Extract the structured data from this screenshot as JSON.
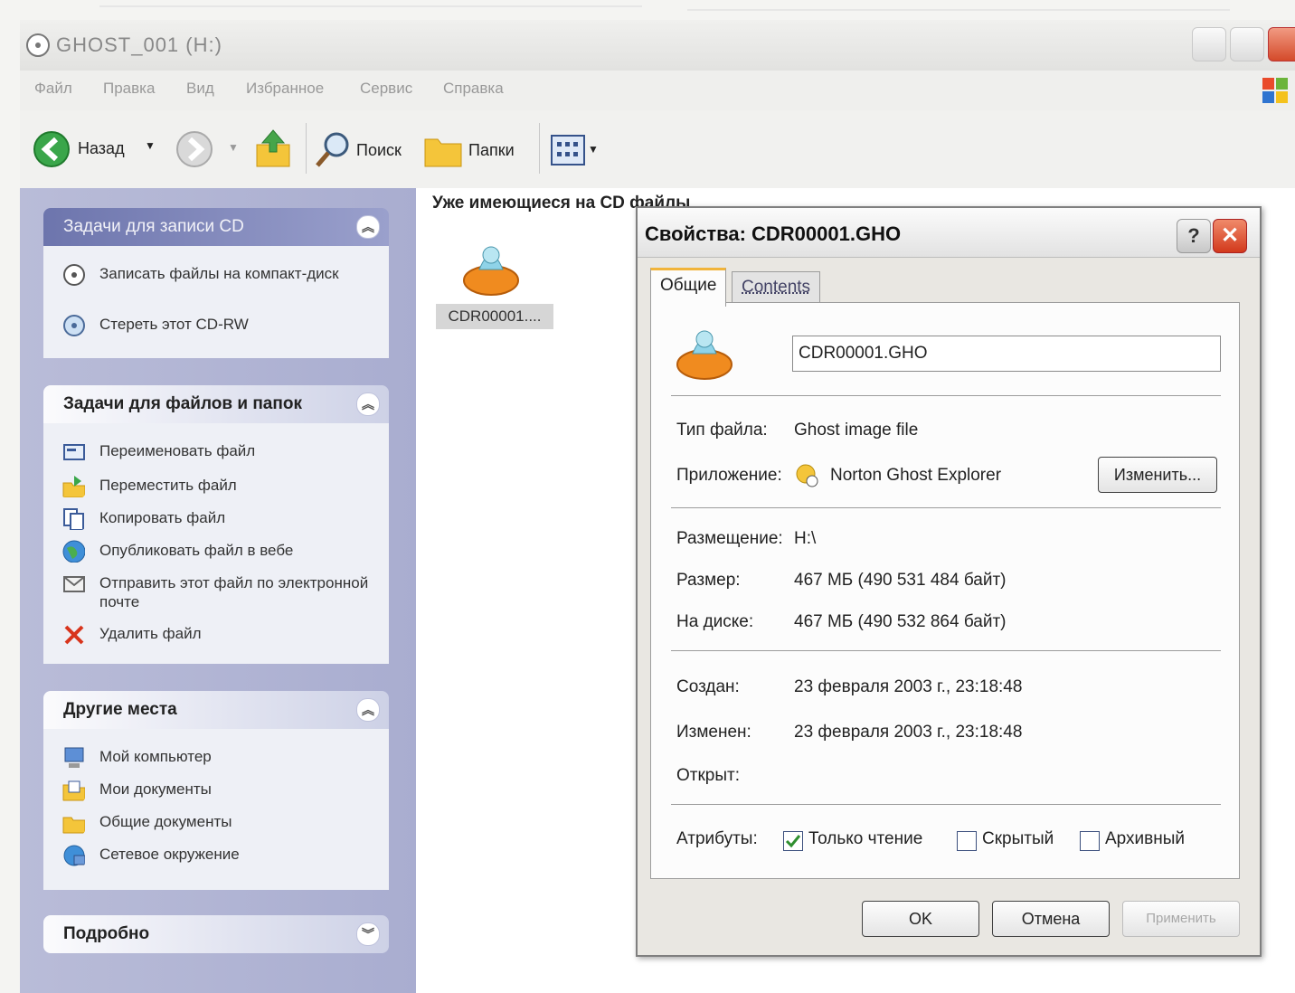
{
  "window": {
    "title": "GHOST_001 (H:)"
  },
  "menubar": {
    "items": [
      "Файл",
      "Правка",
      "Вид",
      "Избранное",
      "Сервис",
      "Справка"
    ]
  },
  "toolbar": {
    "back_label": "Назад",
    "search_label": "Поиск",
    "folders_label": "Папки"
  },
  "taskpane": {
    "cd_tasks": {
      "title": "Задачи для записи CD",
      "items": [
        "Записать файлы на компакт-диск",
        "Стереть этот CD-RW"
      ]
    },
    "file_tasks": {
      "title": "Задачи для файлов и папок",
      "items": [
        "Переименовать файл",
        "Переместить файл",
        "Копировать файл",
        "Опубликовать файл в вебе",
        "Отправить этот файл по электронной почте",
        "Удалить файл"
      ]
    },
    "other_places": {
      "title": "Другие места",
      "items": [
        "Мой компьютер",
        "Мои документы",
        "Общие документы",
        "Сетевое окружение"
      ]
    },
    "details": {
      "title": "Подробно"
    }
  },
  "content": {
    "section_title": "Уже имеющиеся на CD файлы",
    "file_label": "CDR00001...."
  },
  "dialog": {
    "title": "Свойства: CDR00001.GHO",
    "tabs": [
      "Общие",
      "Contents"
    ],
    "filename": "CDR00001.GHO",
    "type_label": "Тип файла:",
    "type_value": "Ghost image file",
    "app_label": "Приложение:",
    "app_value": "Norton Ghost Explorer",
    "change_button": "Изменить...",
    "location_label": "Размещение:",
    "location_value": "H:\\",
    "size_label": "Размер:",
    "size_value": "467 МБ (490 531 484 байт)",
    "disk_size_label": "На диске:",
    "disk_size_value": "467 МБ (490 532 864 байт)",
    "created_label": "Создан:",
    "created_value": "23 февраля 2003 г., 23:18:48",
    "modified_label": "Изменен:",
    "modified_value": "23 февраля 2003 г., 23:18:48",
    "opened_label": "Открыт:",
    "attributes_label": "Атрибуты:",
    "attr_readonly": "Только чтение",
    "attr_hidden": "Скрытый",
    "attr_archive": "Архивный",
    "attr_readonly_checked": true,
    "attr_hidden_checked": false,
    "attr_archive_checked": false,
    "ok_button": "OK",
    "cancel_button": "Отмена",
    "apply_button": "Применить"
  },
  "colors": {
    "taskpane_bg": "#a9add0",
    "cd_panel_header": "#7b82b8",
    "close_red": "#d2391c",
    "check_green": "#3a9a3a"
  }
}
